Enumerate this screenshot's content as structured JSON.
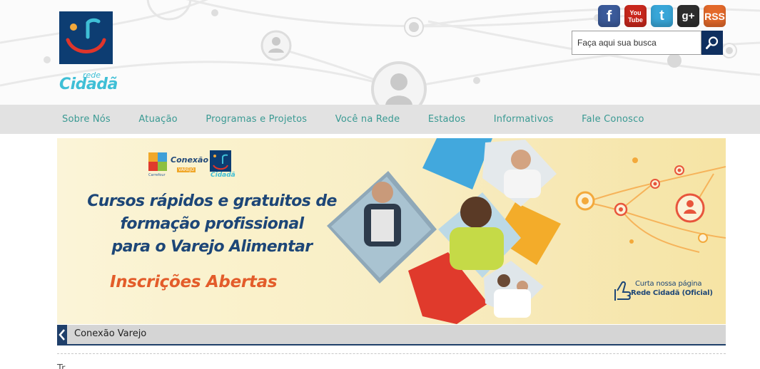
{
  "header": {
    "logo_small": "rede",
    "logo_name": "Cidadã",
    "social": [
      "f",
      "You Tube",
      "t",
      "g+",
      "RSS"
    ],
    "search": {
      "placeholder": "Faça aqui sua busca"
    }
  },
  "nav": {
    "items": [
      "Sobre Nós",
      "Atuação",
      "Programas e Projetos",
      "Você na Rede",
      "Estados",
      "Informativos",
      "Fale Conosco"
    ]
  },
  "banner": {
    "partner_label": "Conexão",
    "partner_sub": "VAREJO",
    "partner_brand": "Carrefour",
    "mini_logo": "Cidadã",
    "headline": [
      "Cursos rápidos e gratuitos de",
      "formação profissional",
      "para o Varejo Alimentar"
    ],
    "cta": "Inscrições Abertas",
    "like_line1": "Curta nossa página",
    "like_line2": "Rede Cidadã (Oficial)"
  },
  "caption": {
    "text": "Conexão Varejo"
  },
  "content": {
    "next_heading": "Tr..."
  },
  "colors": {
    "navy": "#0d3d72",
    "teal_nav_text": "#3a9a93",
    "cyan_brand": "#3fbfd6",
    "orange_cta": "#e35c2a",
    "nav_bg": "#e2e2e2"
  },
  "icons": [
    "facebook-icon",
    "youtube-icon",
    "twitter-icon",
    "google-plus-icon",
    "rss-icon",
    "search-icon",
    "chevron-left-icon",
    "user-icon",
    "like-hand-icon"
  ]
}
